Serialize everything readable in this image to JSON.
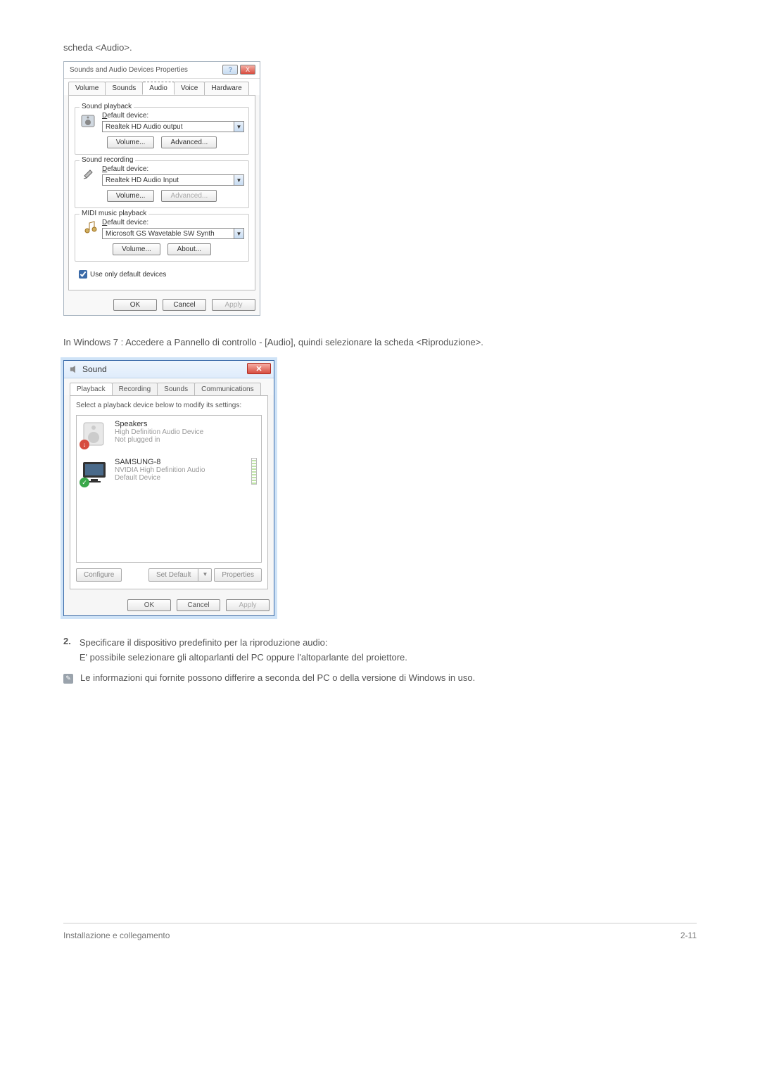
{
  "intro": "scheda <Audio>.",
  "dialogXP": {
    "title": "Sounds and Audio Devices Properties",
    "helpBtn": "?",
    "closeBtn": "X",
    "tabs": [
      "Volume",
      "Sounds",
      "Audio",
      "Voice",
      "Hardware"
    ],
    "activeTab": 2,
    "sections": {
      "playback": {
        "legend": "Sound playback",
        "labelPrefix": "D",
        "labelRest": "efault device:",
        "device": "Realtek HD Audio output",
        "volumeBtn": "Volume...",
        "advancedBtn": "Advanced..."
      },
      "recording": {
        "legend": "Sound recording",
        "labelPrefix": "D",
        "labelRest": "efault device:",
        "device": "Realtek HD Audio Input",
        "volumeBtn": "Volume...",
        "advancedBtn": "Advanced..."
      },
      "midi": {
        "legend": "MIDI music playback",
        "labelPrefix": "D",
        "labelRest": "efault device:",
        "device": "Microsoft GS Wavetable SW Synth",
        "volumeBtn": "Volume...",
        "aboutBtn": "About..."
      }
    },
    "checkboxLabel": "Use only default devices",
    "checkboxChecked": true,
    "buttons": {
      "ok": "OK",
      "cancel": "Cancel",
      "apply": "Apply"
    }
  },
  "textBetween": "In Windows 7 : Accedere a Pannello di controllo - [Audio], quindi selezionare la scheda <Riproduzione>.",
  "dialogW7": {
    "title": "Sound",
    "tabs": [
      "Playback",
      "Recording",
      "Sounds",
      "Communications"
    ],
    "activeTab": 0,
    "prompt": "Select a playback device below to modify its settings:",
    "devices": [
      {
        "name": "Speakers",
        "line2": "High Definition Audio Device",
        "line3": "Not plugged in",
        "badge": "red",
        "meter": false
      },
      {
        "name": "SAMSUNG-8",
        "line2": "NVIDIA High Definition Audio",
        "line3": "Default Device",
        "badge": "green",
        "meter": true
      }
    ],
    "configure": "Configure",
    "setDefault": "Set Default",
    "properties": "Properties",
    "buttons": {
      "ok": "OK",
      "cancel": "Cancel",
      "apply": "Apply"
    }
  },
  "numItem": {
    "num": "2.",
    "line1": "Specificare il dispositivo predefinito per la riproduzione audio:",
    "line2": "E' possibile selezionare gli altoparlanti del PC oppure l'altoparlante del proiettore."
  },
  "note": "Le informazioni qui fornite possono differire a seconda del PC o della versione di Windows in uso.",
  "footer": {
    "left": "Installazione e collegamento",
    "right": "2-11"
  }
}
